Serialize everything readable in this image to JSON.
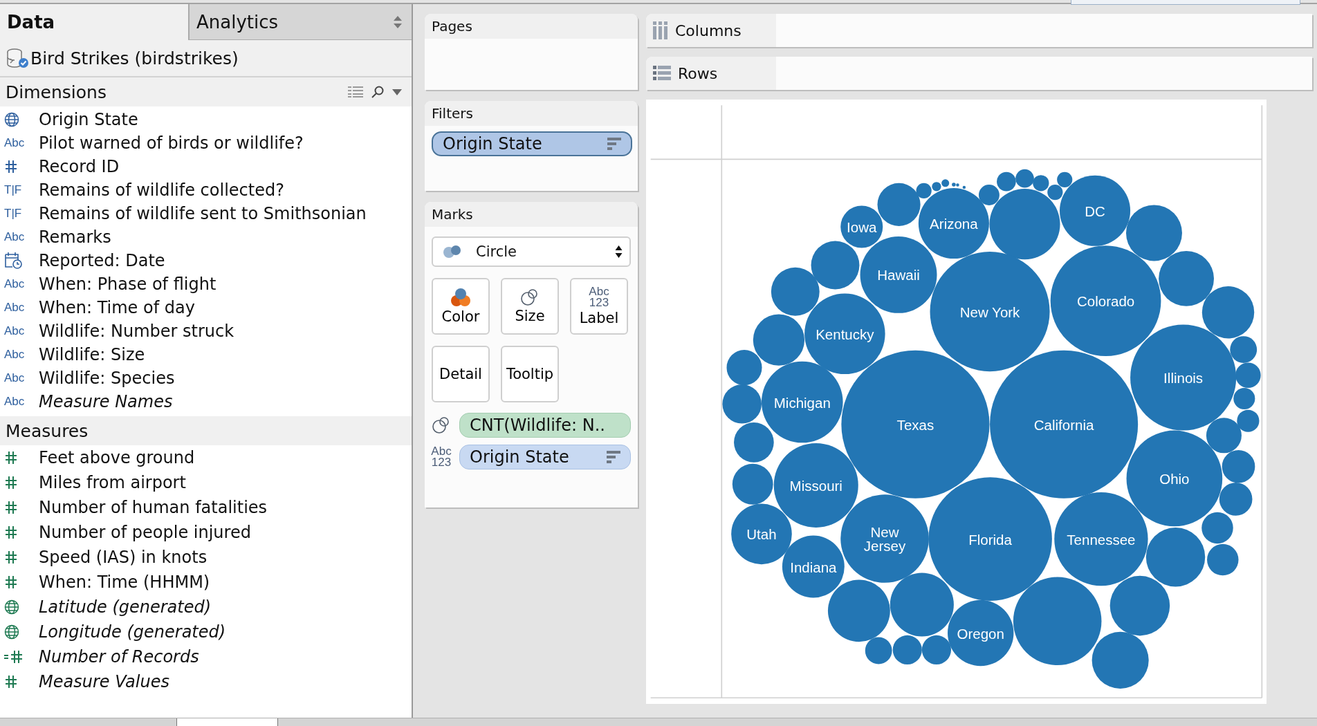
{
  "data_pane": {
    "tabs": [
      {
        "label": "Data",
        "selected": true
      },
      {
        "label": "Analytics",
        "selected": false
      }
    ],
    "data_source": "Bird Strikes (birdstrikes)",
    "dimensions": {
      "title": "Dimensions",
      "fields": [
        {
          "kind": "geo",
          "name": "Origin State",
          "italic": false
        },
        {
          "kind": "text",
          "type_icon": "Abc",
          "name": "Pilot warned of birds or wildlife?",
          "italic": false
        },
        {
          "kind": "number",
          "name": "Record ID",
          "italic": false
        },
        {
          "kind": "text",
          "type_icon": "T|F",
          "name": "Remains of wildlife collected?",
          "italic": false
        },
        {
          "kind": "text",
          "type_icon": "T|F",
          "name": "Remains of wildlife sent to Smithsonian",
          "italic": false
        },
        {
          "kind": "text",
          "type_icon": "Abc",
          "name": "Remarks",
          "italic": false
        },
        {
          "kind": "date",
          "name": "Reported: Date",
          "italic": false
        },
        {
          "kind": "text",
          "type_icon": "Abc",
          "name": "When: Phase of flight",
          "italic": false
        },
        {
          "kind": "text",
          "type_icon": "Abc",
          "name": "When: Time of day",
          "italic": false
        },
        {
          "kind": "text",
          "type_icon": "Abc",
          "name": "Wildlife: Number struck",
          "italic": false
        },
        {
          "kind": "text",
          "type_icon": "Abc",
          "name": "Wildlife: Size",
          "italic": false
        },
        {
          "kind": "text",
          "type_icon": "Abc",
          "name": "Wildlife: Species",
          "italic": false
        },
        {
          "kind": "text",
          "type_icon": "Abc",
          "name": "Measure Names",
          "italic": true
        }
      ]
    },
    "measures": {
      "title": "Measures",
      "fields": [
        {
          "kind": "number",
          "name": "Feet above ground",
          "italic": false
        },
        {
          "kind": "number",
          "name": "Miles from airport",
          "italic": false
        },
        {
          "kind": "number",
          "name": "Number of human fatalities",
          "italic": false
        },
        {
          "kind": "number",
          "name": "Number of people injured",
          "italic": false
        },
        {
          "kind": "number",
          "name": "Speed (IAS) in knots",
          "italic": false
        },
        {
          "kind": "number",
          "name": "When: Time (HHMM)",
          "italic": false
        },
        {
          "kind": "geo",
          "name": "Latitude (generated)",
          "italic": true
        },
        {
          "kind": "geo",
          "name": "Longitude (generated)",
          "italic": true
        },
        {
          "kind": "count",
          "name": "Number of Records",
          "italic": true
        },
        {
          "kind": "number",
          "name": "Measure Values",
          "italic": true
        }
      ]
    }
  },
  "shelves": {
    "pages": {
      "title": "Pages"
    },
    "filters": {
      "title": "Filters",
      "pills": [
        {
          "label": "Origin State",
          "kind": "dimension",
          "sorted": true,
          "selected": true
        }
      ]
    },
    "marks": {
      "title": "Marks",
      "mark_type": "Circle",
      "cards": [
        {
          "kind": "color",
          "label": "Color"
        },
        {
          "kind": "size",
          "label": "Size"
        },
        {
          "kind": "label",
          "label": "Label",
          "icon_text": [
            "Abc",
            "123"
          ]
        },
        {
          "kind": "detail",
          "label": "Detail"
        },
        {
          "kind": "tooltip",
          "label": "Tooltip"
        }
      ],
      "encodings": [
        {
          "label": "CNT(Wildlife: N..",
          "kind": "measure",
          "sorted": false
        },
        {
          "icon_text": [
            "Abc",
            "123"
          ],
          "label": "Origin State",
          "kind": "dimension",
          "sorted": true
        }
      ]
    }
  },
  "columns": {
    "title": "Columns"
  },
  "rows": {
    "title": "Rows"
  },
  "view": {
    "bubbles": [
      {
        "label": "Iowa"
      },
      {
        "label": "Arizona"
      },
      {
        "label": "DC"
      },
      {
        "label": "Hawaii"
      },
      {
        "label": "New York"
      },
      {
        "label": "Colorado"
      },
      {
        "label": "Kentucky"
      },
      {
        "label": "Illinois"
      },
      {
        "label": "Michigan"
      },
      {
        "label": "Texas"
      },
      {
        "label": "California"
      },
      {
        "label": "Missouri"
      },
      {
        "label": "Ohio"
      },
      {
        "label": "Utah"
      },
      {
        "label": "New Jersey"
      },
      {
        "label": "Florida"
      },
      {
        "label": "Tennessee"
      },
      {
        "label": "Indiana"
      },
      {
        "label": "Oregon"
      }
    ]
  }
}
